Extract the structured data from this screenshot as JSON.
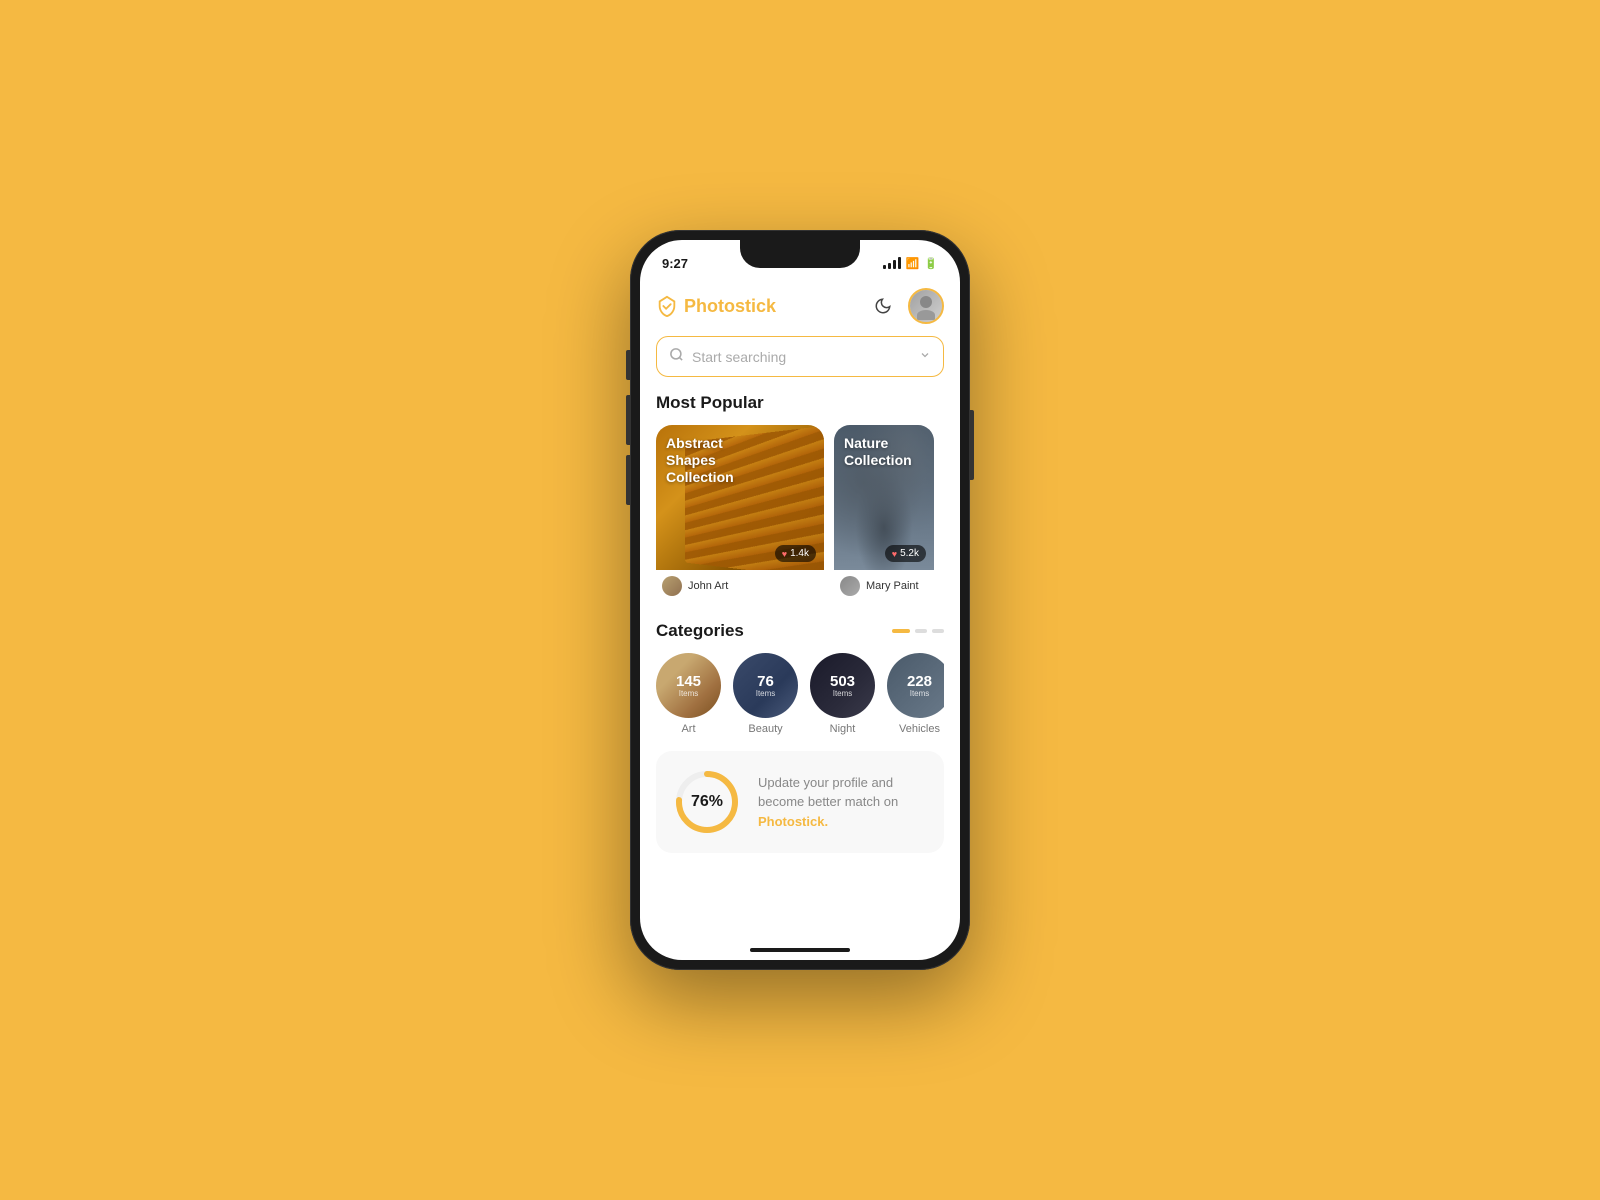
{
  "phone": {
    "status_time": "9:27",
    "app_name": "Photostick",
    "search_placeholder": "Start searching",
    "most_popular_title": "Most Popular",
    "categories_title": "Categories",
    "collections": [
      {
        "title": "Abstract Shapes Collection",
        "likes": "1.4k",
        "author": "John Art",
        "type": "abstract"
      },
      {
        "title": "Nature Collection",
        "likes": "5.2k",
        "author": "Mary Paint",
        "type": "nature"
      }
    ],
    "categories": [
      {
        "name": "Art",
        "count": "145",
        "items_label": "Items"
      },
      {
        "name": "Beauty",
        "count": "76",
        "items_label": "Items"
      },
      {
        "name": "Night",
        "count": "503",
        "items_label": "Items"
      },
      {
        "name": "Vehicles",
        "count": "228",
        "items_label": "Items"
      }
    ],
    "profile_progress": 76,
    "profile_text": "Update your profile and become better match on ",
    "profile_brand": "Photostick.",
    "home_indicator_visible": true
  }
}
